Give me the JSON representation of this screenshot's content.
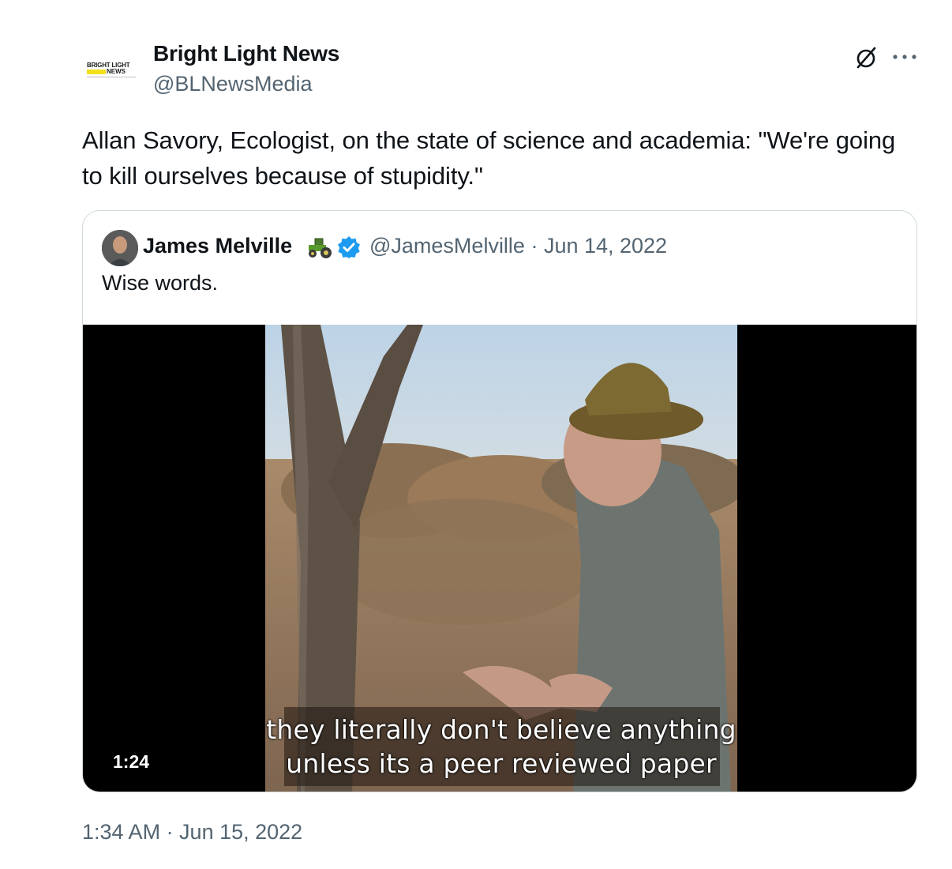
{
  "author": {
    "display_name": "Bright Light News",
    "handle": "@BLNewsMedia",
    "avatar_logo_text_top": "BRIGHT LIGHT",
    "avatar_logo_text_news": "NEWS",
    "avatar_logo_accent": "#f2e01a"
  },
  "actions": {
    "grok_icon": "grok-icon",
    "more_icon": "more-options-icon"
  },
  "tweet": {
    "text": "Allan Savory, Ecologist, on the state of science and academia: \"We're going to kill ourselves because of stupidity.\"",
    "timestamp": "1:34 AM · Jun 15, 2022"
  },
  "quoted_tweet": {
    "display_name": "James Melville",
    "emoji_icon": "tractor-icon",
    "verified": true,
    "verified_color": "#1d9bf0",
    "meta": "@JamesMelville · Jun 14, 2022",
    "text": "Wise words.",
    "video": {
      "duration": "1:24",
      "caption_line_1": "they literally don't believe anything",
      "caption_line_2": "unless its a peer reviewed paper"
    }
  },
  "colors": {
    "text_primary": "#0f1419",
    "text_secondary": "#536471",
    "border": "#cfd9de"
  }
}
